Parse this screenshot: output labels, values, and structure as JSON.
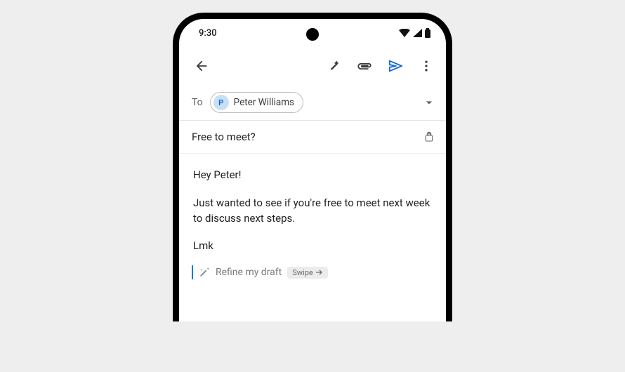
{
  "status": {
    "time": "9:30"
  },
  "toolbar": {},
  "compose": {
    "to_label": "To",
    "recipient": {
      "initial": "P",
      "name": "Peter Williams"
    },
    "subject": "Free to meet?",
    "body": {
      "line1": "Hey Peter!",
      "line2": "Just wanted to see if you're free to meet next week to discuss next steps.",
      "line3": "Lmk"
    },
    "refine": {
      "label": "Refine my draft",
      "swipe_label": "Swipe"
    }
  }
}
